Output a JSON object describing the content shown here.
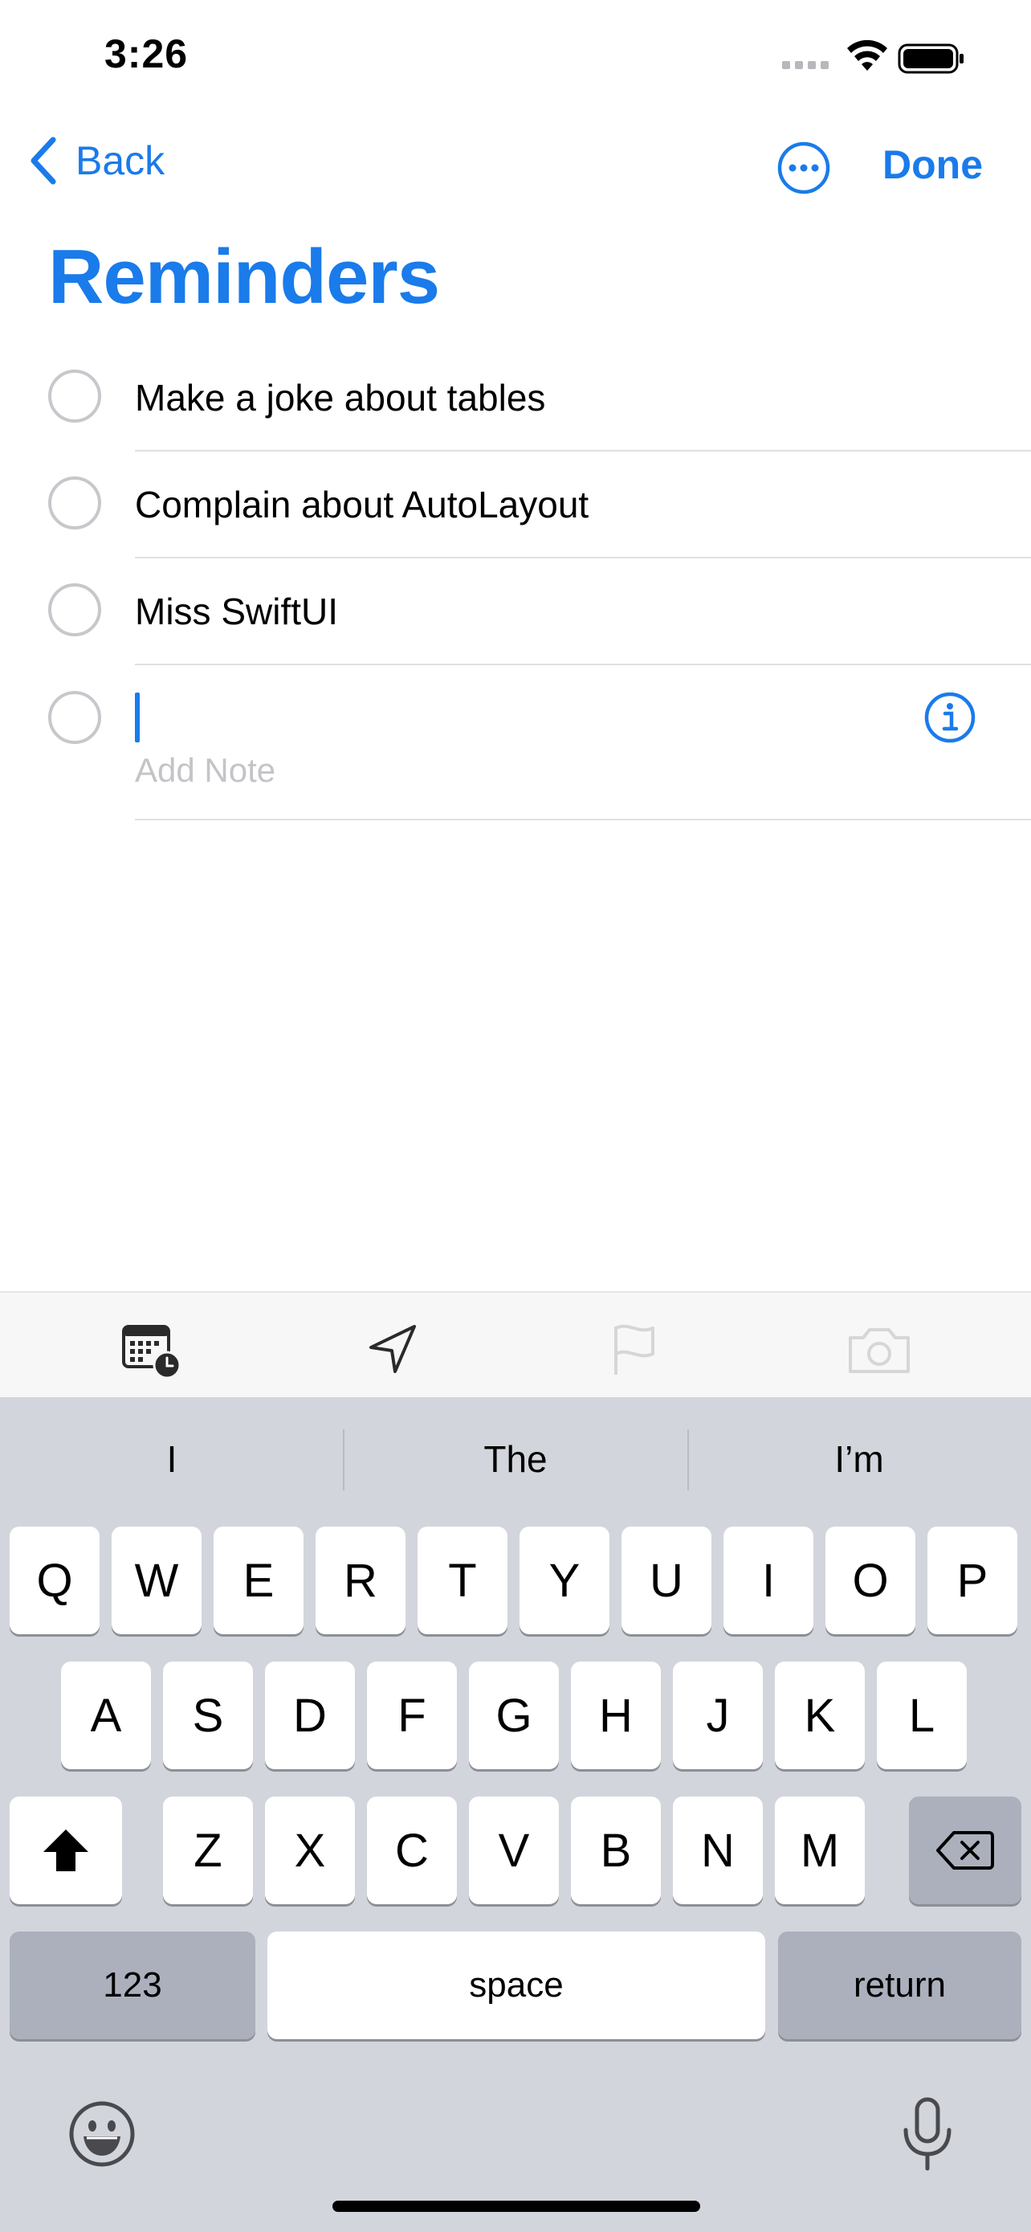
{
  "status_bar": {
    "time": "3:26"
  },
  "nav": {
    "back_label": "Back",
    "done_label": "Done"
  },
  "title": "Reminders",
  "reminders": [
    {
      "text": "Make a joke about tables"
    },
    {
      "text": "Complain about AutoLayout"
    },
    {
      "text": "Miss SwiftUI"
    }
  ],
  "new_item": {
    "note_placeholder": "Add Note"
  },
  "toolbar": {
    "icons": [
      "calendar-clock-icon",
      "location-arrow-icon",
      "flag-icon",
      "camera-icon"
    ]
  },
  "keyboard": {
    "suggestions": [
      "I",
      "The",
      "I’m"
    ],
    "row1": [
      "Q",
      "W",
      "E",
      "R",
      "T",
      "Y",
      "U",
      "I",
      "O",
      "P"
    ],
    "row2": [
      "A",
      "S",
      "D",
      "F",
      "G",
      "H",
      "J",
      "K",
      "L"
    ],
    "row3": [
      "Z",
      "X",
      "C",
      "V",
      "B",
      "N",
      "M"
    ],
    "numbers_label": "123",
    "space_label": "space",
    "return_label": "return"
  },
  "colors": {
    "accent": "#1a7bea",
    "keyboard_bg": "#d2d5db"
  }
}
